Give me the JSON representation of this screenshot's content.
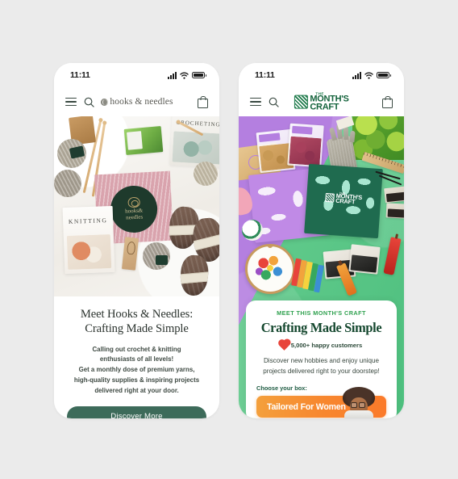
{
  "canvas": {
    "background": "#ebebeb"
  },
  "phones": [
    {
      "id": "hooks-needles",
      "status": {
        "time": "11:11"
      },
      "nav": {
        "menu_icon": "hamburger-icon",
        "search_icon": "search-icon",
        "cart_icon": "shopping-bag-icon",
        "brand": "hooks & needles"
      },
      "hero": {
        "alt": "flat lay of yarn balls, knitting needles, knitting magazine and pink hooks & needles box"
      },
      "content": {
        "heading_line1": "Meet Hooks & Needles:",
        "heading_line2": "Crafting Made Simple",
        "body_line1": "Calling out crochet & knitting",
        "body_line2": "enthusiasts of all levels!",
        "body_line3": "Get a monthly dose of premium yarns,",
        "body_line4": "high-quality supplies & inspiring projects",
        "body_line5": "delivered right at your door.",
        "cta_label": "Discover More",
        "cta_color": "#3d6b5a"
      }
    },
    {
      "id": "the-months-craft",
      "status": {
        "time": "11:11"
      },
      "nav": {
        "menu_icon": "hamburger-icon",
        "search_icon": "search-icon",
        "cart_icon": "shopping-bag-icon",
        "brand_the": "THE",
        "brand_word1": "MONTH'S",
        "brand_word2": "CRAFT",
        "brand_color": "#14633c"
      },
      "hero": {
        "alt": "colorful purple and green flat lay with craft boxes, gloves, plant, embroidery hoop, floss and sauce bottles",
        "box_the": "THE",
        "box_word1": "MONTH'S",
        "box_word2": "CRAFT"
      },
      "content": {
        "eyebrow": "MEET THIS MONTH'S CRAFT",
        "heading": "Crafting Made Simple",
        "social_proof": "5,000+ happy customers",
        "heart_icon": "heart-icon",
        "body_line1": "Discover new hobbies and enjoy unique",
        "body_line2": "projects delivered right to your doorstep!",
        "choose_label": "Choose your box:",
        "cta_label": "Tailored For Women",
        "cta_arrow": "→",
        "cta_color": "#f7882f"
      }
    }
  ]
}
